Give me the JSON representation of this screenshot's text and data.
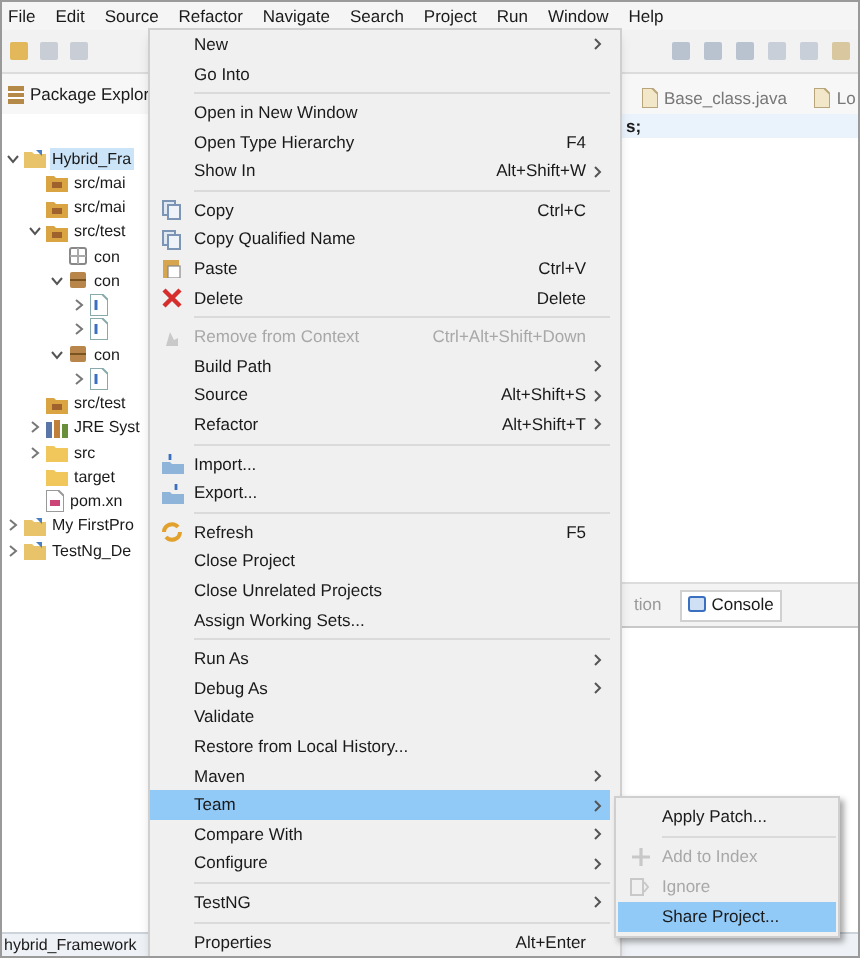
{
  "menu_bar": [
    "File",
    "Edit",
    "Source",
    "Refactor",
    "Navigate",
    "Search",
    "Project",
    "Run",
    "Window",
    "Help"
  ],
  "package_explorer": {
    "title": "Package Explor",
    "tree": [
      {
        "label": "Hybrid_Fra",
        "kind": "project",
        "expanded": true,
        "selected": true,
        "children": [
          {
            "label": "src/mai",
            "kind": "source"
          },
          {
            "label": "src/mai",
            "kind": "source"
          },
          {
            "label": "src/test",
            "kind": "source",
            "expanded": true,
            "children": [
              {
                "label": "con",
                "kind": "empty-package"
              },
              {
                "label": "con",
                "kind": "package",
                "expanded": true,
                "children": [
                  {
                    "kind": "java",
                    "expanded": false
                  },
                  {
                    "kind": "java",
                    "expanded": false
                  }
                ]
              },
              {
                "label": "con",
                "kind": "package",
                "expanded": true,
                "children": [
                  {
                    "kind": "java",
                    "expanded": false
                  }
                ]
              }
            ]
          },
          {
            "label": "src/test",
            "kind": "source"
          },
          {
            "label": "JRE Syst",
            "kind": "library",
            "expanded": false
          },
          {
            "label": "src",
            "kind": "folder",
            "expanded": false
          },
          {
            "label": "target",
            "kind": "folder"
          },
          {
            "label": "pom.xn",
            "kind": "xml"
          }
        ]
      },
      {
        "label": "My FirstPro",
        "kind": "project",
        "expanded": false,
        "selected": false
      },
      {
        "label": "TestNg_De",
        "kind": "project",
        "expanded": false,
        "selected": false
      }
    ]
  },
  "editor": {
    "tabs": [
      "Base_class.java",
      "Lo"
    ],
    "code_line": "s;"
  },
  "bottom_panel": {
    "tabs": [
      {
        "label": "tion",
        "selected": false
      },
      {
        "label": "Console",
        "selected": true
      }
    ]
  },
  "status_bar": "hybrid_Framework",
  "context_menu": [
    {
      "kind": "item",
      "label": "New",
      "submenu": true
    },
    {
      "kind": "item",
      "label": "Go Into"
    },
    {
      "kind": "separator"
    },
    {
      "kind": "item",
      "label": "Open in New Window"
    },
    {
      "kind": "item",
      "label": "Open Type Hierarchy",
      "shortcut": "F4"
    },
    {
      "kind": "item",
      "label": "Show In",
      "shortcut": "Alt+Shift+W",
      "submenu": true
    },
    {
      "kind": "separator"
    },
    {
      "kind": "item",
      "label": "Copy",
      "shortcut": "Ctrl+C"
    },
    {
      "kind": "item",
      "label": "Copy Qualified Name"
    },
    {
      "kind": "item",
      "label": "Paste",
      "shortcut": "Ctrl+V"
    },
    {
      "kind": "item",
      "label": "Delete",
      "shortcut": "Delete"
    },
    {
      "kind": "separator"
    },
    {
      "kind": "item",
      "label": "Remove from Context",
      "shortcut": "Ctrl+Alt+Shift+Down",
      "disabled": true
    },
    {
      "kind": "item",
      "label": "Build Path",
      "submenu": true
    },
    {
      "kind": "item",
      "label": "Source",
      "shortcut": "Alt+Shift+S",
      "submenu": true
    },
    {
      "kind": "item",
      "label": "Refactor",
      "shortcut": "Alt+Shift+T",
      "submenu": true
    },
    {
      "kind": "separator"
    },
    {
      "kind": "item",
      "label": "Import..."
    },
    {
      "kind": "item",
      "label": "Export..."
    },
    {
      "kind": "separator"
    },
    {
      "kind": "item",
      "label": "Refresh",
      "shortcut": "F5"
    },
    {
      "kind": "item",
      "label": "Close Project"
    },
    {
      "kind": "item",
      "label": "Close Unrelated Projects"
    },
    {
      "kind": "item",
      "label": "Assign Working Sets..."
    },
    {
      "kind": "separator"
    },
    {
      "kind": "item",
      "label": "Run As",
      "submenu": true
    },
    {
      "kind": "item",
      "label": "Debug As",
      "submenu": true
    },
    {
      "kind": "item",
      "label": "Validate"
    },
    {
      "kind": "item",
      "label": "Restore from Local History..."
    },
    {
      "kind": "item",
      "label": "Maven",
      "submenu": true
    },
    {
      "kind": "item",
      "label": "Team",
      "submenu": true,
      "selected": true
    },
    {
      "kind": "item",
      "label": "Compare With",
      "submenu": true
    },
    {
      "kind": "item",
      "label": "Configure",
      "submenu": true
    },
    {
      "kind": "separator"
    },
    {
      "kind": "item",
      "label": "TestNG",
      "submenu": true
    },
    {
      "kind": "separator"
    },
    {
      "kind": "item",
      "label": "Properties",
      "shortcut": "Alt+Enter"
    }
  ],
  "team_submenu": [
    {
      "kind": "item",
      "label": "Apply Patch..."
    },
    {
      "kind": "separator"
    },
    {
      "kind": "item",
      "label": "Add to Index",
      "disabled": true
    },
    {
      "kind": "item",
      "label": "Ignore",
      "disabled": true
    },
    {
      "kind": "item",
      "label": "Share Project...",
      "selected": true
    }
  ]
}
